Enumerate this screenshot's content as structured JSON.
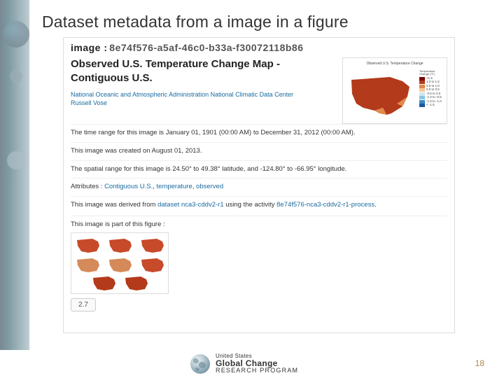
{
  "slide_title": "Dataset metadata from a image in a figure",
  "header": {
    "label": "image :",
    "id": "8e74f576-a5af-46c0-b33a-f30072118b86"
  },
  "image_title": "Observed U.S. Temperature Change Map - Contiguous U.S.",
  "credits": {
    "org_link": "National Oceanic and Atmospheric Administration National Climatic Data Center",
    "person_link": "Russell Vose"
  },
  "meta": {
    "time_range": "The time range for this image is January 01, 1901 (00:00 AM) to December 31, 2012 (00:00 AM).",
    "created": "This image was created on August 01, 2013.",
    "spatial": "The spatial range for this image is 24.50° to 49.38° latitude, and -124.80° to -66.95° longitude.",
    "attrs_label": "Attributes :",
    "attrs_links": [
      "Contiguous U.S.",
      "temperature",
      "observed"
    ],
    "derived_pre": "This image was derived from ",
    "derived_dataset": "dataset nca3-cddv2-r1",
    "derived_mid": " using the activity ",
    "derived_activity": "8e74f576-nca3-cddv2-r1-process",
    "figure_intro": "This image is part of this figure :",
    "figure_number": "2.7"
  },
  "map": {
    "title": "Observed U.S. Temperature Change",
    "legend_title": "Temperature Change (°F)",
    "legend": [
      {
        "c": "#7a0a0a",
        "t": ">1.5"
      },
      {
        "c": "#b63a1a",
        "t": "1.0 to 1.5"
      },
      {
        "c": "#e08a4a",
        "t": "0.5 to 1.0"
      },
      {
        "c": "#f5c79a",
        "t": "0.0 to 0.5"
      },
      {
        "c": "#cfe5ef",
        "t": "-0.5 to 0.0"
      },
      {
        "c": "#8ac5e0",
        "t": "-1.0 to -0.5"
      },
      {
        "c": "#3a8ac5",
        "t": "-1.5 to -1.0"
      },
      {
        "c": "#1a5a9a",
        "t": "< -1.5"
      }
    ]
  },
  "footer": {
    "org_line1": "United States",
    "org_line2": "Global Change",
    "org_line3": "RESEARCH PROGRAM",
    "page": "18"
  }
}
